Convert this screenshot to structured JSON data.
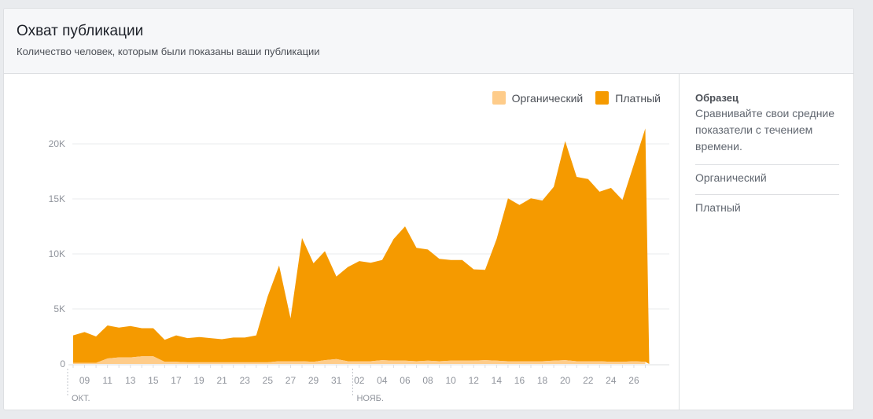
{
  "header": {
    "title": "Охват публикации",
    "subtitle": "Количество человек, которым были показаны ваши публикации"
  },
  "side_panel": {
    "title": "Образец",
    "text": "Сравнивайте свои средние показатели с течением времени.",
    "items": [
      "Органический",
      "Платный"
    ]
  },
  "colors": {
    "organic": "#fecc8a",
    "paid": "#f59a00",
    "grid": "#e9ebee",
    "axis_text": "#90949c"
  },
  "chart_data": {
    "type": "area",
    "stacked": true,
    "legend_position": "top-right",
    "grid": true,
    "ylim": [
      0,
      22000
    ],
    "yticks": [
      0,
      5000,
      10000,
      15000,
      20000
    ],
    "ytick_labels": [
      "0",
      "5K",
      "10K",
      "15K",
      "20K"
    ],
    "x": [
      "2017-10-08",
      "2017-10-09",
      "2017-10-10",
      "2017-10-11",
      "2017-10-12",
      "2017-10-13",
      "2017-10-14",
      "2017-10-15",
      "2017-10-16",
      "2017-10-17",
      "2017-10-18",
      "2017-10-19",
      "2017-10-20",
      "2017-10-21",
      "2017-10-22",
      "2017-10-23",
      "2017-10-24",
      "2017-10-25",
      "2017-10-26",
      "2017-10-27",
      "2017-10-28",
      "2017-10-29",
      "2017-10-30",
      "2017-10-31",
      "2017-11-01",
      "2017-11-02",
      "2017-11-03",
      "2017-11-04",
      "2017-11-05",
      "2017-11-06",
      "2017-11-07",
      "2017-11-08",
      "2017-11-09",
      "2017-11-10",
      "2017-11-11",
      "2017-11-12",
      "2017-11-13",
      "2017-11-14",
      "2017-11-15",
      "2017-11-16",
      "2017-11-17",
      "2017-11-18",
      "2017-11-19",
      "2017-11-20",
      "2017-11-21",
      "2017-11-22",
      "2017-11-23",
      "2017-11-24",
      "2017-11-25",
      "2017-11-26",
      "2017-11-27"
    ],
    "xtick_labels": [
      {
        "label": "09",
        "index": 1
      },
      {
        "label": "11",
        "index": 3
      },
      {
        "label": "13",
        "index": 5
      },
      {
        "label": "15",
        "index": 7
      },
      {
        "label": "17",
        "index": 9
      },
      {
        "label": "19",
        "index": 11
      },
      {
        "label": "21",
        "index": 13
      },
      {
        "label": "23",
        "index": 15
      },
      {
        "label": "25",
        "index": 17
      },
      {
        "label": "27",
        "index": 19
      },
      {
        "label": "29",
        "index": 21
      },
      {
        "label": "31",
        "index": 23
      },
      {
        "label": "02",
        "index": 25
      },
      {
        "label": "04",
        "index": 27
      },
      {
        "label": "06",
        "index": 29
      },
      {
        "label": "08",
        "index": 31
      },
      {
        "label": "10",
        "index": 33
      },
      {
        "label": "12",
        "index": 35
      },
      {
        "label": "14",
        "index": 37
      },
      {
        "label": "16",
        "index": 39
      },
      {
        "label": "18",
        "index": 41
      },
      {
        "label": "20",
        "index": 43
      },
      {
        "label": "22",
        "index": 45
      },
      {
        "label": "24",
        "index": 47
      },
      {
        "label": "26",
        "index": 49
      }
    ],
    "month_labels": [
      {
        "label": "ОКТ.",
        "index": 0
      },
      {
        "label": "НОЯБ.",
        "index": 24.5
      }
    ],
    "series": [
      {
        "name": "Органический",
        "values": [
          100,
          100,
          100,
          500,
          600,
          600,
          700,
          700,
          200,
          200,
          150,
          150,
          150,
          150,
          150,
          150,
          150,
          150,
          250,
          250,
          250,
          200,
          350,
          450,
          250,
          250,
          250,
          350,
          300,
          300,
          250,
          300,
          250,
          300,
          300,
          300,
          350,
          300,
          250,
          250,
          250,
          250,
          300,
          350,
          250,
          250,
          250,
          200,
          200,
          250,
          200
        ]
      },
      {
        "name": "Платный",
        "values": [
          2500,
          2800,
          2400,
          3000,
          2700,
          2850,
          2550,
          2550,
          2000,
          2400,
          2200,
          2300,
          2200,
          2100,
          2250,
          2250,
          2450,
          6000,
          8700,
          3900,
          11200,
          8950,
          9900,
          7500,
          8550,
          9100,
          8950,
          9100,
          11050,
          12200,
          10300,
          10100,
          9300,
          9150,
          9150,
          8300,
          8200,
          11050,
          14800,
          14200,
          14800,
          14600,
          15800,
          19900,
          16750,
          16550,
          15400,
          15800,
          14700,
          17900,
          21200
        ]
      }
    ]
  }
}
